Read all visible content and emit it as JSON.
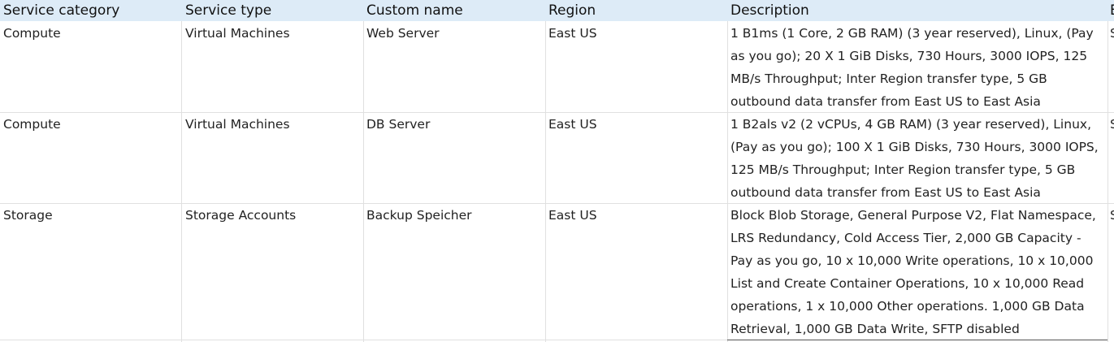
{
  "headers": {
    "service_category": "Service category",
    "service_type": "Service type",
    "custom_name": "Custom name",
    "region": "Region",
    "description": "Description",
    "next_clipped": "E"
  },
  "rows": [
    {
      "service_category": "Compute",
      "service_type": "Virtual Machines",
      "custom_name": "Web Server",
      "region": "East US",
      "description_lines": [
        "1 B1ms (1 Core, 2 GB RAM) (3 year reserved), Linux,  (Pay",
        "as you go); 20 X 1 GiB Disks, 730 Hours, 3000 IOPS, 125",
        "MB/s Throughput; Inter Region transfer type, 5 GB",
        "outbound data transfer from East US to East Asia"
      ],
      "next_clipped": "S"
    },
    {
      "service_category": "Compute",
      "service_type": "Virtual Machines",
      "custom_name": "DB Server",
      "region": "East US",
      "description_lines": [
        "1 B2als v2 (2 vCPUs, 4 GB RAM) (3 year reserved), Linux,",
        "(Pay as you go); 100 X 1 GiB Disks, 730 Hours, 3000 IOPS,",
        "125 MB/s Throughput; Inter Region transfer type, 5 GB",
        "outbound data transfer from East US to East Asia"
      ],
      "next_clipped": "S"
    },
    {
      "service_category": "Storage",
      "service_type": "Storage Accounts",
      "custom_name": "Backup Speicher",
      "region": "East US",
      "description_lines": [
        "Block Blob Storage, General Purpose V2, Flat Namespace,",
        "LRS Redundancy, Cold Access Tier, 2,000 GB Capacity -",
        "Pay as you go, 10 x 10,000 Write operations, 10 x 10,000",
        "List and Create Container Operations, 10 x 10,000 Read",
        "operations, 1 x 10,000 Other operations. 1,000 GB Data",
        "Retrieval, 1,000 GB Data Write, SFTP disabled"
      ],
      "next_clipped": "S"
    }
  ]
}
